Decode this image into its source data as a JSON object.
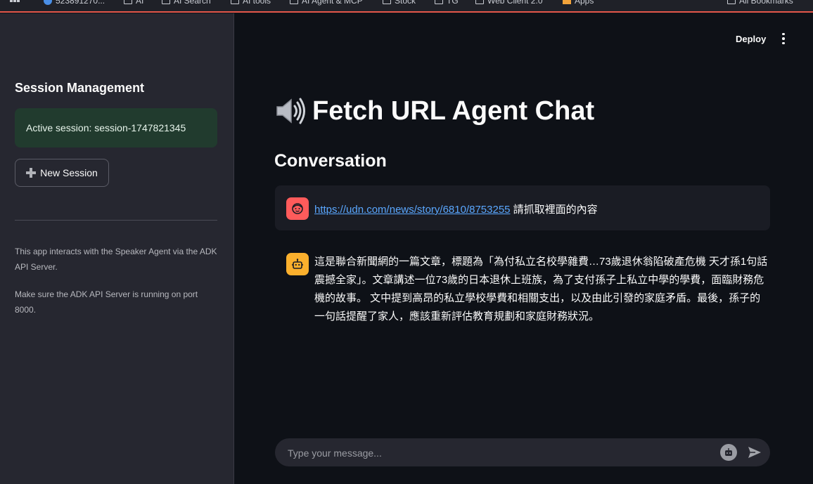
{
  "browser": {
    "bookmarks": [
      "523891270...",
      "AI",
      "AI Search",
      "AI tools",
      "AI Agent & MCP",
      "Stock",
      "TG",
      "Web Client 2.0",
      "Apps",
      "All Bookmarks"
    ]
  },
  "sidebar": {
    "heading": "Session Management",
    "active_session": "Active session: session-1747821345",
    "new_session_label": "New Session",
    "info_1": "This app interacts with the Speaker Agent via the ADK API Server.",
    "info_2": "Make sure the ADK API Server is running on port 8000."
  },
  "header": {
    "deploy_label": "Deploy"
  },
  "main": {
    "title": "Fetch URL Agent Chat",
    "subtitle": "Conversation",
    "messages": [
      {
        "role": "user",
        "link": "https://udn.com/news/story/6810/8753255",
        "text": " 請抓取裡面的內容"
      },
      {
        "role": "assistant",
        "text": "這是聯合新聞網的一篇文章，標題為「為付私立名校學雜費…73歲退休翁陷破產危機 天才孫1句話震撼全家」。文章講述一位73歲的日本退休上班族，為了支付孫子上私立中學的學費，面臨財務危機的故事。 文中提到高昂的私立學校學費和相關支出，以及由此引發的家庭矛盾。最後，孫子的一句話提醒了家人，應該重新評估教育規劃和家庭財務狀況。"
      }
    ]
  },
  "chat_input": {
    "placeholder": "Type your message..."
  },
  "colors": {
    "background": "#0e1117",
    "sidebar": "#262730",
    "success_box": "#213b2e",
    "user_avatar": "#ff5b5b",
    "bot_avatar": "#fbb02d",
    "link": "#5aa7ff"
  }
}
